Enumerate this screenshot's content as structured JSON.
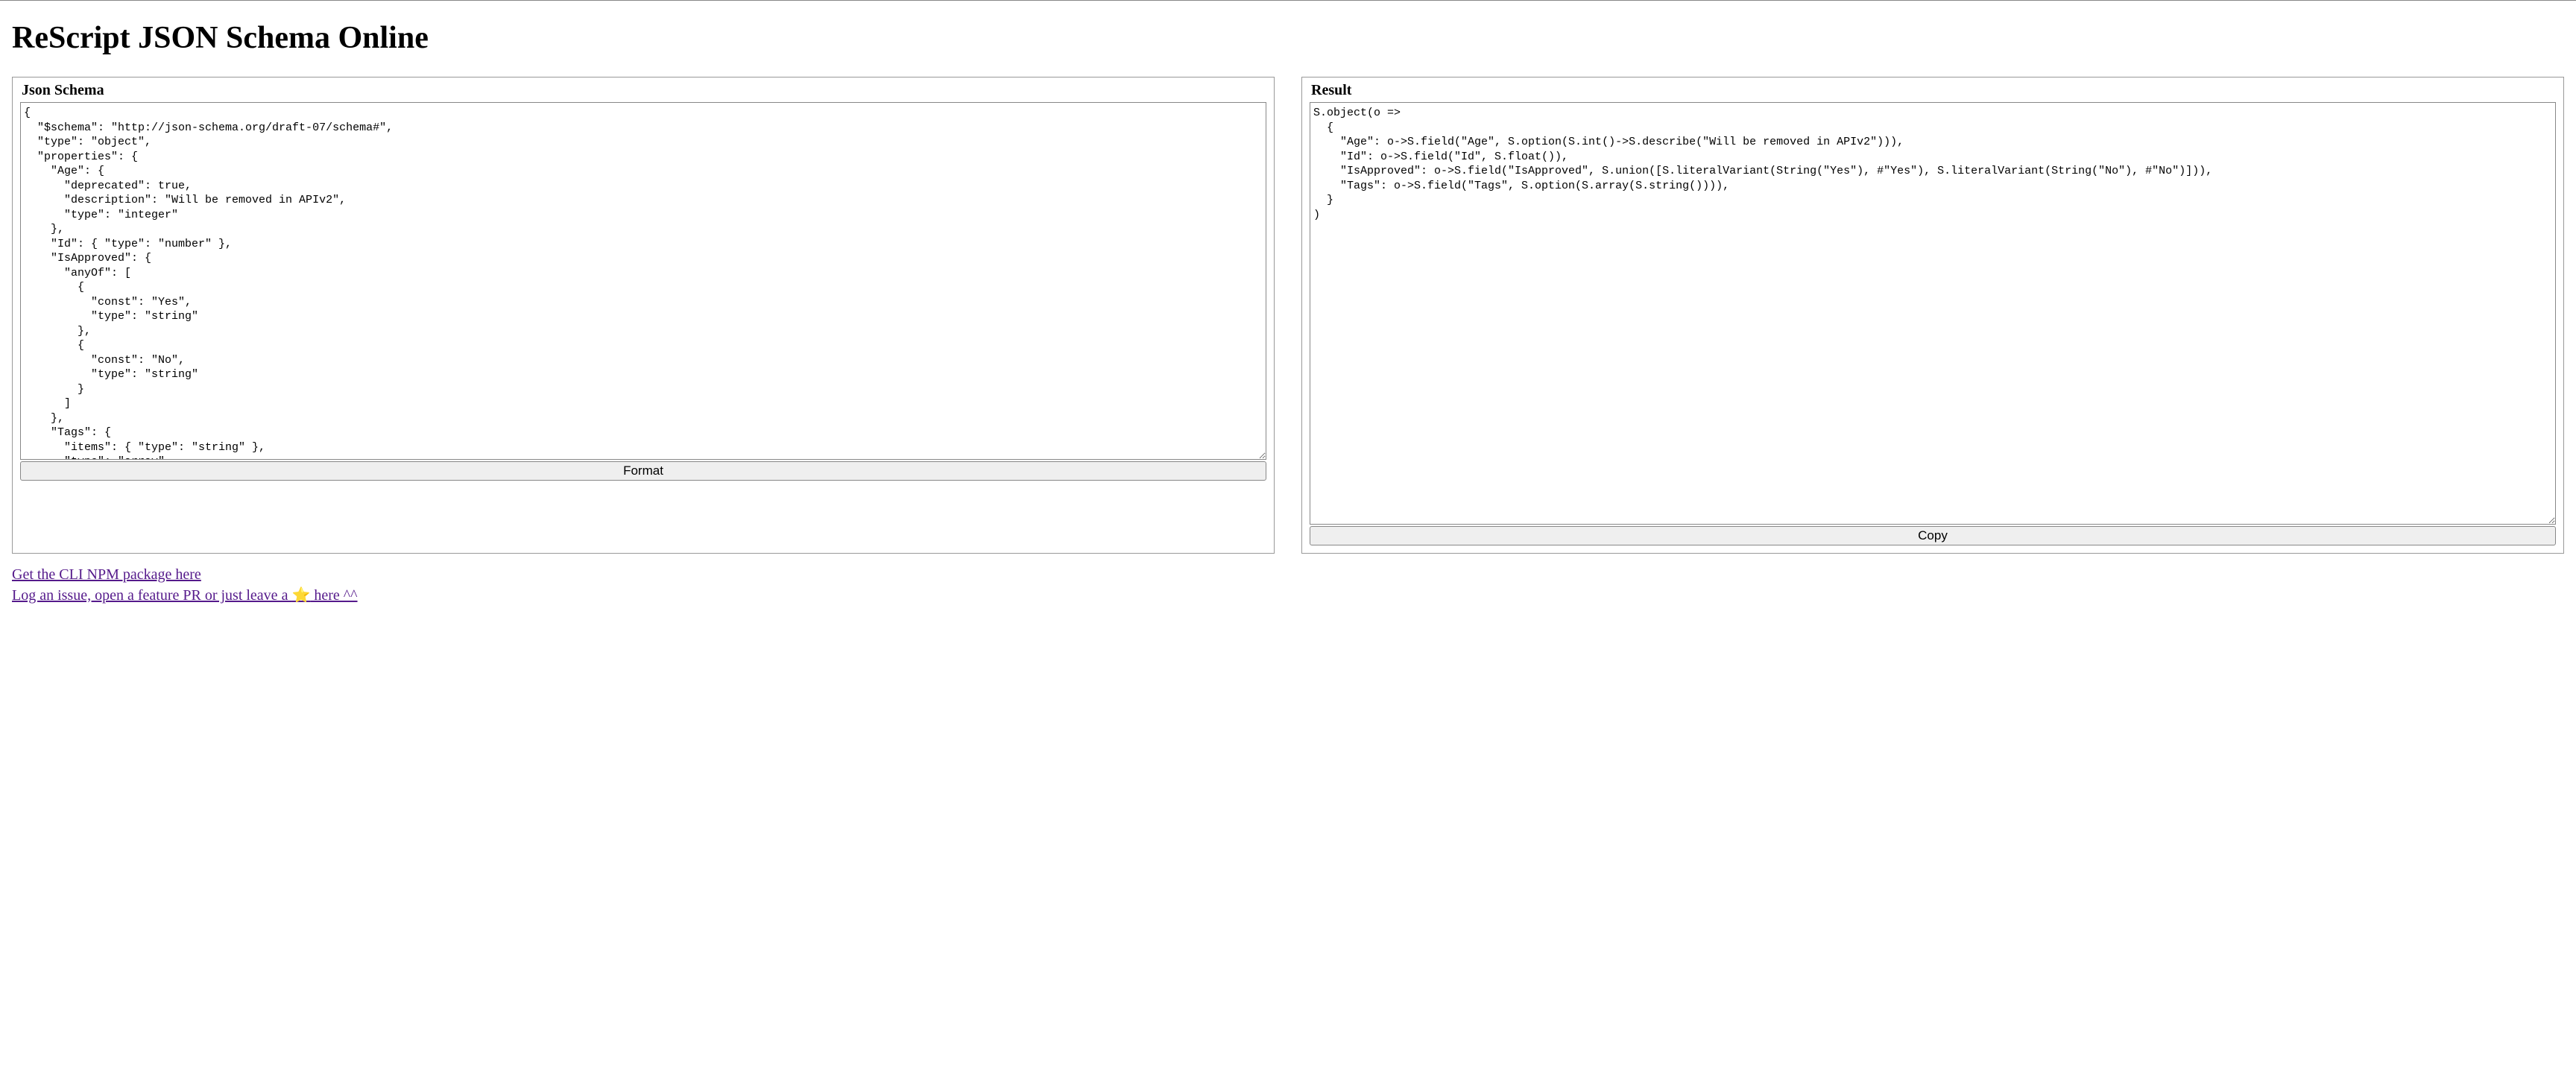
{
  "page": {
    "title": "ReScript JSON Schema Online"
  },
  "leftPanel": {
    "title": "Json Schema",
    "content": "{\n  \"$schema\": \"http://json-schema.org/draft-07/schema#\",\n  \"type\": \"object\",\n  \"properties\": {\n    \"Age\": {\n      \"deprecated\": true,\n      \"description\": \"Will be removed in APIv2\",\n      \"type\": \"integer\"\n    },\n    \"Id\": { \"type\": \"number\" },\n    \"IsApproved\": {\n      \"anyOf\": [\n        {\n          \"const\": \"Yes\",\n          \"type\": \"string\"\n        },\n        {\n          \"const\": \"No\",\n          \"type\": \"string\"\n        }\n      ]\n    },\n    \"Tags\": {\n      \"items\": { \"type\": \"string\" },\n      \"type\": \"array\"\n    }",
    "button": "Format"
  },
  "rightPanel": {
    "title": "Result",
    "content": "S.object(o =>\n  {\n    \"Age\": o->S.field(\"Age\", S.option(S.int()->S.describe(\"Will be removed in APIv2\"))),\n    \"Id\": o->S.field(\"Id\", S.float()),\n    \"IsApproved\": o->S.field(\"IsApproved\", S.union([S.literalVariant(String(\"Yes\"), #\"Yes\"), S.literalVariant(String(\"No\"), #\"No\")])),\n    \"Tags\": o->S.field(\"Tags\", S.option(S.array(S.string()))),\n  }\n)",
    "button": "Copy"
  },
  "links": {
    "cli": "Get the CLI NPM package here",
    "issue_pre": "Log an issue, open a feature PR or just leave a ",
    "issue_star": "⭐",
    "issue_post": " here ^^"
  }
}
